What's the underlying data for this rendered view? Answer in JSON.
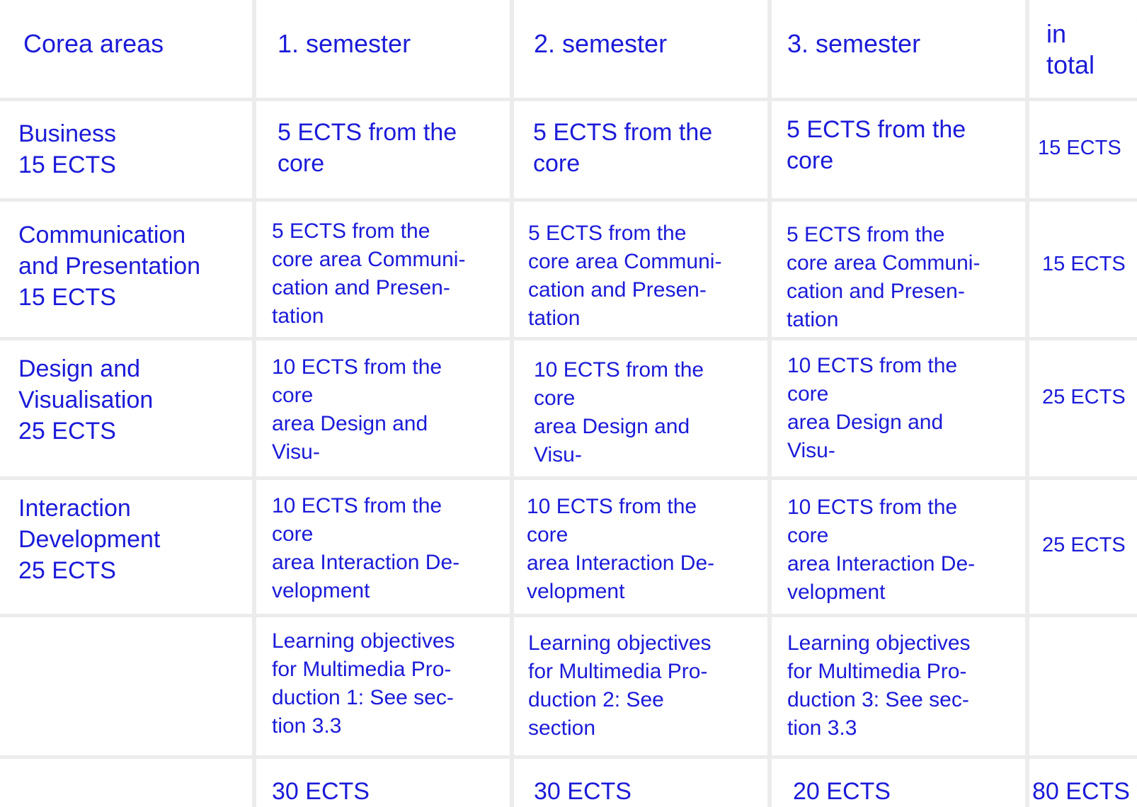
{
  "header": {
    "areas": "Corea areas",
    "sem1": "1. semester",
    "sem2": "2. semester",
    "sem3": "3. semester",
    "total": "in\ntotal"
  },
  "rows": [
    {
      "area": "Business\n15 ECTS",
      "s1": "5 ECTS from the\ncore",
      "s2": "5 ECTS from the\ncore",
      "s3": "5 ECTS from the\ncore",
      "total": "15 ECTS"
    },
    {
      "area": "Communication\nand  Presentation\n15 ECTS",
      "s1": "5 ECTS from the\ncore area Communi-\ncation and Presen-\ntation",
      "s2": "5 ECTS from the\ncore area Communi-\ncation and Presen-\ntation",
      "s3": "5 ECTS from the\ncore area Communi-\ncation and Presen-\ntation",
      "total": "15 ECTS"
    },
    {
      "area": "Design and\nVisualisation\n25 ECTS",
      "s1": "10 ECTS from the\ncore\narea Design and\nVisu-",
      "s2": "10 ECTS from the\ncore\narea Design and\nVisu-",
      "s3": "10 ECTS from the\ncore\narea Design and\nVisu-",
      "total": "25 ECTS"
    },
    {
      "area": "Interaction\nDevelopment\n25 ECTS",
      "s1": "10 ECTS from the\ncore\narea Interaction De-\nvelopment",
      "s2": "10 ECTS from the\ncore\narea Interaction De-\nvelopment",
      "s3": "10 ECTS from the\ncore\narea Interaction De-\nvelopment",
      "total": "25 ECTS"
    },
    {
      "area": "",
      "s1": "Learning objectives\nfor Multimedia Pro-\nduction 1: See sec-\ntion 3.3",
      "s2": "Learning objectives\nfor Multimedia Pro-\nduction 2: See\nsection",
      "s3": "Learning objectives\nfor Multimedia Pro-\nduction 3: See sec-\ntion 3.3",
      "total": ""
    }
  ],
  "sum": {
    "area": "",
    "s1": "30 ECTS",
    "s2": "30 ECTS",
    "s3": "20 ECTS",
    "total": "80 ECTS"
  }
}
